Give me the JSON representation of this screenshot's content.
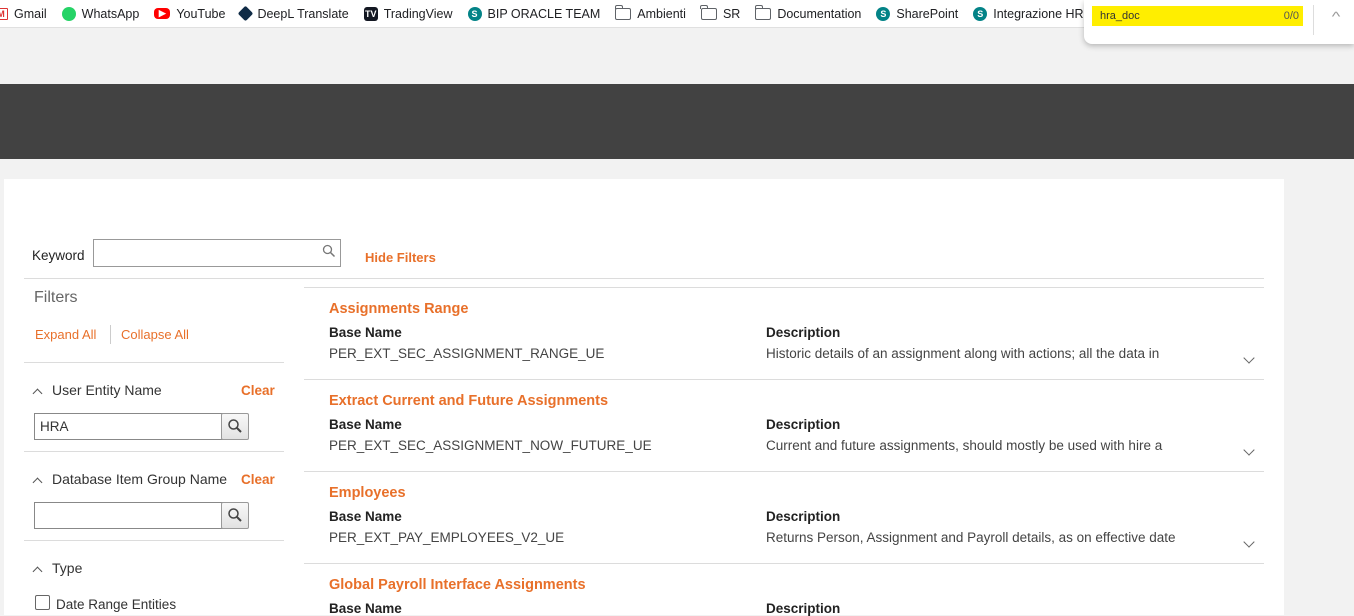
{
  "bookmarks": [
    {
      "label": "Gmail",
      "icon": "gmail-icon"
    },
    {
      "label": "WhatsApp",
      "icon": "whatsapp-icon"
    },
    {
      "label": "YouTube",
      "icon": "youtube-icon"
    },
    {
      "label": "DeepL Translate",
      "icon": "deepl-icon"
    },
    {
      "label": "TradingView",
      "icon": "tradingview-icon"
    },
    {
      "label": "BIP ORACLE TEAM",
      "icon": "sharepoint-icon"
    },
    {
      "label": "Ambienti",
      "icon": "folder-icon"
    },
    {
      "label": "SR",
      "icon": "folder-icon"
    },
    {
      "label": "Documentation",
      "icon": "folder-icon"
    },
    {
      "label": "SharePoint",
      "icon": "sharepoint-icon"
    },
    {
      "label": "Integrazione HR N",
      "icon": "sharepoint-icon"
    }
  ],
  "find_bar": {
    "query": "hra_doc",
    "count": "0/0"
  },
  "search": {
    "keyword_label": "Keyword",
    "keyword_value": "",
    "hide_filters": "Hide Filters"
  },
  "filters": {
    "title": "Filters",
    "expand_all": "Expand All",
    "collapse_all": "Collapse All",
    "user_entity": {
      "label": "User Entity Name",
      "clear": "Clear",
      "value": "HRA"
    },
    "db_item_group": {
      "label": "Database Item Group Name",
      "clear": "Clear",
      "value": ""
    },
    "type": {
      "label": "Type",
      "option": "Date Range Entities"
    }
  },
  "results": {
    "base_name_label": "Base Name",
    "description_label": "Description",
    "items": [
      {
        "title": "Assignments Range",
        "base_name": "PER_EXT_SEC_ASSIGNMENT_RANGE_UE",
        "description": "Historic details of an assignment along with actions; all the data in"
      },
      {
        "title": "Extract Current and Future Assignments",
        "base_name": "PER_EXT_SEC_ASSIGNMENT_NOW_FUTURE_UE",
        "description": "Current and future assignments, should mostly be used with hire a"
      },
      {
        "title": "Employees",
        "base_name": "PER_EXT_PAY_EMPLOYEES_V2_UE",
        "description": "Returns Person, Assignment and Payroll details, as on effective date"
      },
      {
        "title": "Global Payroll Interface Assignments",
        "base_name": "",
        "description": ""
      }
    ]
  },
  "colors": {
    "accent": "#e8702a",
    "banner": "#424242",
    "find_highlight": "#ffee00"
  }
}
